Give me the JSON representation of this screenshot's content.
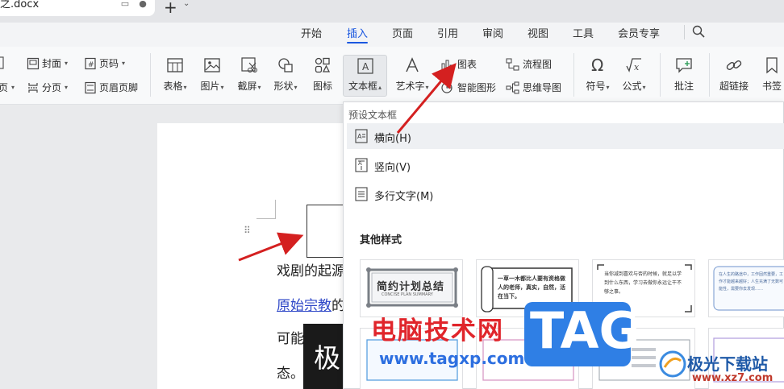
{
  "titlebar": {
    "doc_name": "之.docx"
  },
  "menu": {
    "items": [
      {
        "label": "开始",
        "active": false
      },
      {
        "label": "插入",
        "active": true
      },
      {
        "label": "页面",
        "active": false
      },
      {
        "label": "引用",
        "active": false
      },
      {
        "label": "审阅",
        "active": false
      },
      {
        "label": "视图",
        "active": false
      },
      {
        "label": "工具",
        "active": false
      },
      {
        "label": "会员专享",
        "active": false
      }
    ],
    "accent_color": "#1a57e0"
  },
  "ribbon": {
    "page_group": {
      "cover": "封面",
      "page_number": "页码",
      "page_break": "分页",
      "header_footer": "页眉页脚",
      "blank_page_partial": "页"
    },
    "table": "表格",
    "picture": "图片",
    "screenshot": "截屏",
    "shape": "形状",
    "icon": "图标",
    "textbox": "文本框",
    "wordart": "艺术字",
    "chart": "图表",
    "smartart": "智能图形",
    "flowchart": "流程图",
    "mindmap": "思维导图",
    "symbol": "符号",
    "formula": "公式",
    "comment": "批注",
    "hyperlink": "超链接",
    "bookmark": "书签"
  },
  "document": {
    "line1": "戏剧的起源",
    "line2_link": "原始宗教",
    "line2_rest": "的",
    "line3": "可能",
    "line4": "态。",
    "overlay_char": "极"
  },
  "dropdown": {
    "header": "预设文本框",
    "items": [
      {
        "label": "横向(H)",
        "icon": "horizontal-textbox-icon"
      },
      {
        "label": "竖向(V)",
        "icon": "vertical-textbox-icon"
      },
      {
        "label": "多行文字(M)",
        "icon": "multiline-text-icon"
      }
    ],
    "section_title": "其他样式",
    "card1_title": "简约计划总结",
    "card1_sub": "CONCISE PLAN SUMMARY",
    "card2_text": "一草一木都比人要有资格做人的老师，真实，自然，活在当下。",
    "card3_text": "当你减到喜欢与否的时候，就足以学到什么东西，学习去做你永远让干不够之事。",
    "card4_text": "在人生的路途中，工作固然重要，工作才能越来越好；人生充满了无数可能性，需要你去发现……"
  },
  "watermarks": {
    "cn": "电脑技术网",
    "url": "www.tagxp.com",
    "tag": "TAG",
    "site_cn": "极光下载站",
    "site_url": "www.xz7.com"
  }
}
